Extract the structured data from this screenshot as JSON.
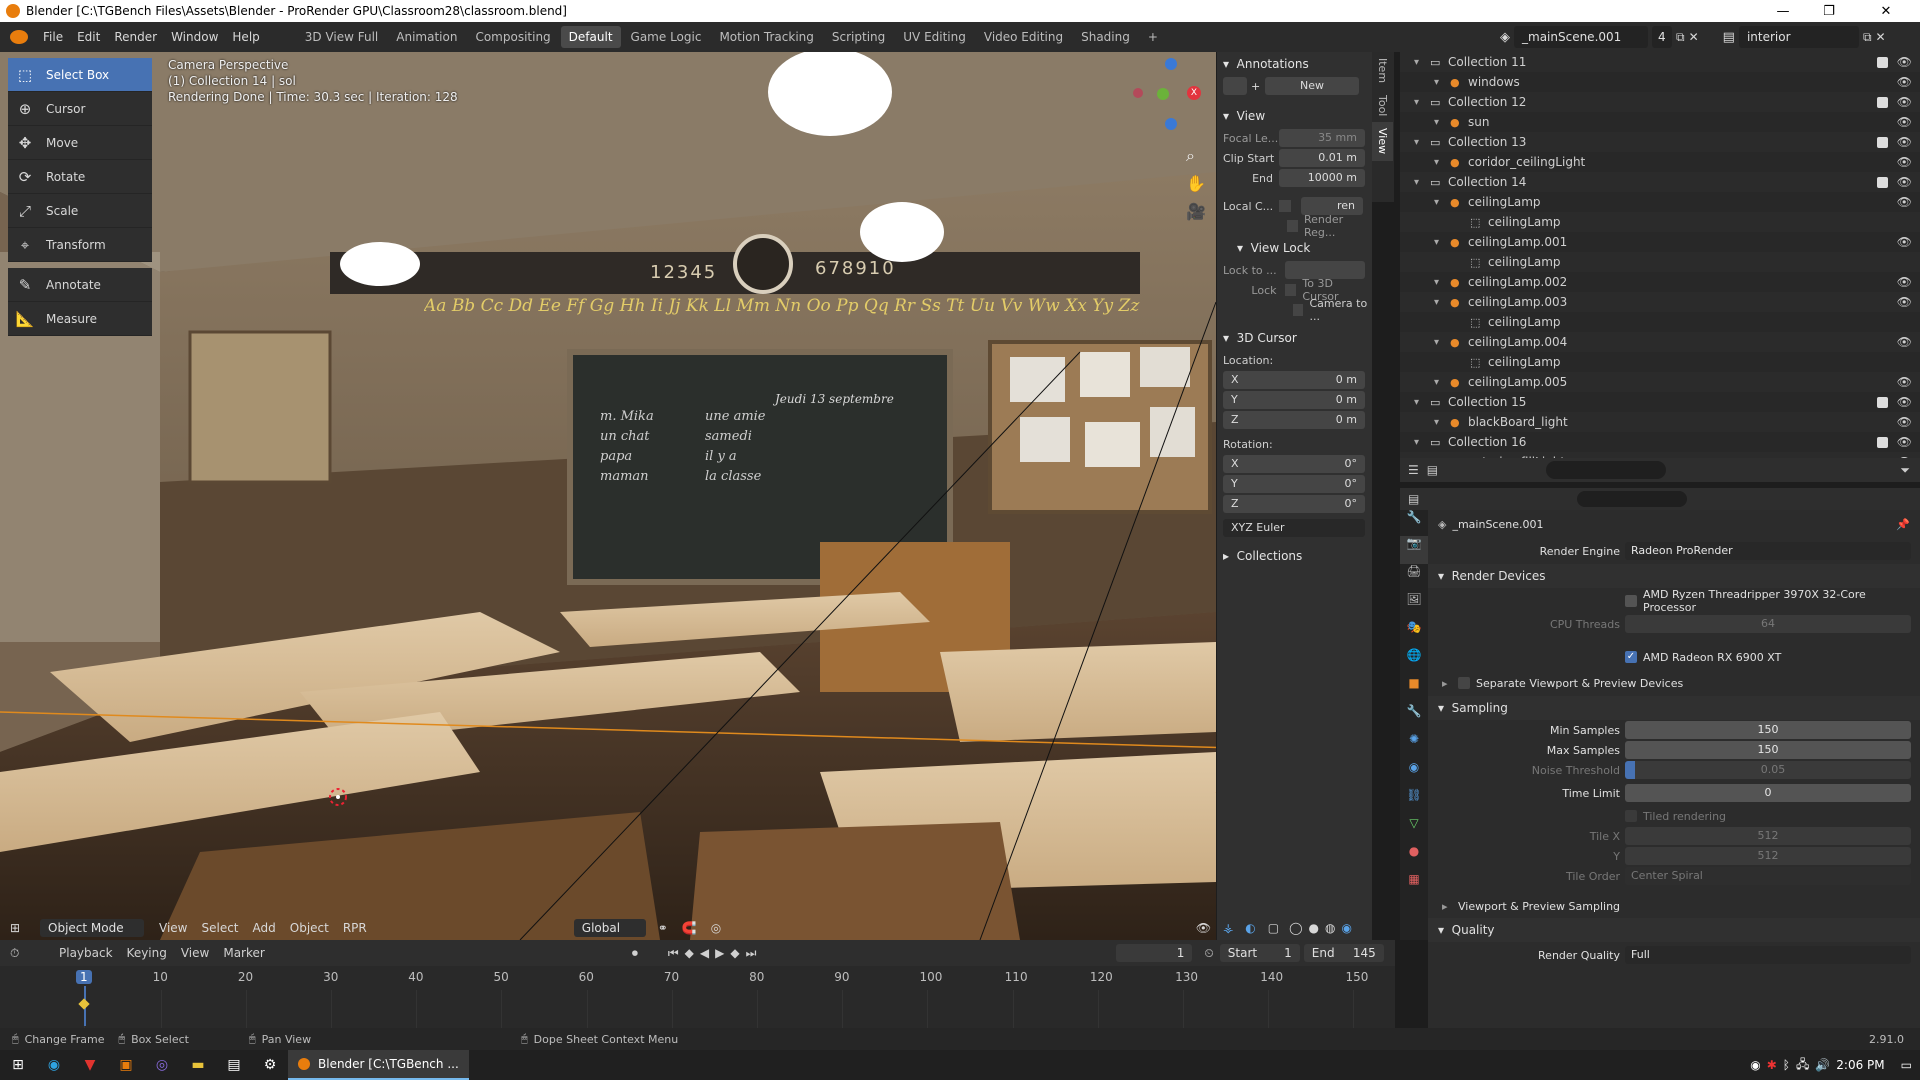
{
  "window": {
    "title": "Blender [C:\\TGBench Files\\Assets\\Blender - ProRender GPU\\Classroom28\\classroom.blend]",
    "minimize": "—",
    "maximize": "❐",
    "close": "✕"
  },
  "menu": [
    "File",
    "Edit",
    "Render",
    "Window",
    "Help"
  ],
  "workspaces": [
    "3D View Full",
    "Animation",
    "Compositing",
    "Default",
    "Game Logic",
    "Motion Tracking",
    "Scripting",
    "UV Editing",
    "Video Editing",
    "Shading"
  ],
  "active_workspace": "Default",
  "add_workspace": "+",
  "scene": {
    "name": "_mainScene.001",
    "users": "4",
    "view_layer": "interior"
  },
  "viewport": {
    "info_line1": "Camera Perspective",
    "info_line2": "(1) Collection 14 | sol",
    "info_line3": "Rendering Done | Time: 30.3 sec | Iteration: 128",
    "alphabet": "Aa Bb  Cc Dd Ee Ff Gg Hh Ii Jj Kk Ll Mm Nn Oo Pp Qq Rr Ss Tt Uu Vv Ww Xx Yy Zz",
    "numbers_left": "12345",
    "numbers_right": "678910",
    "board_date": "Jeudi 13 septembre",
    "board_words_1": [
      "m. Mika",
      "un chat",
      "papa",
      "maman"
    ],
    "board_words_2": [
      "une amie",
      "samedi",
      "il y a",
      "la classe"
    ]
  },
  "tools": [
    {
      "label": "Select Box",
      "icon": "select-box-icon",
      "active": true
    },
    {
      "label": "Cursor",
      "icon": "cursor-icon"
    },
    {
      "label": "Move",
      "icon": "move-icon"
    },
    {
      "label": "Rotate",
      "icon": "rotate-icon"
    },
    {
      "label": "Scale",
      "icon": "scale-icon"
    },
    {
      "label": "Transform",
      "icon": "transform-icon"
    },
    {
      "label": "Annotate",
      "icon": "annotate-icon"
    },
    {
      "label": "Measure",
      "icon": "measure-icon"
    }
  ],
  "npanel": {
    "tabs": [
      "Item",
      "Tool",
      "View"
    ],
    "annotations": "Annotations",
    "new": "New",
    "view": "View",
    "focal_label": "Focal Le...",
    "focal_value": "35 mm",
    "clip_start_label": "Clip Start",
    "clip_start_value": "0.01 m",
    "end_label": "End",
    "end_value": "10000 m",
    "local_camera_label": "Local C...",
    "local_camera_value": "ren",
    "render_region": "Render Reg...",
    "view_lock": "View Lock",
    "lock_to_label": "Lock to ...",
    "lock_label": "Lock",
    "to_3d_cursor": "To 3D Cursor",
    "camera_to": "Camera to ...",
    "cursor": "3D Cursor",
    "location": "Location:",
    "x": "X",
    "y": "Y",
    "z": "Z",
    "loc_x": "0 m",
    "loc_y": "0 m",
    "loc_z": "0 m",
    "rotation": "Rotation:",
    "rot_x": "0°",
    "rot_y": "0°",
    "rot_z": "0°",
    "rotation_mode": "XYZ Euler",
    "collections": "Collections"
  },
  "outliner": [
    {
      "label": "Collection 11",
      "depth": 0,
      "type": "collection",
      "checkbox": true
    },
    {
      "label": "windows",
      "depth": 1,
      "type": "object"
    },
    {
      "label": "Collection 12",
      "depth": 0,
      "type": "collection",
      "checkbox": true
    },
    {
      "label": "sun",
      "depth": 1,
      "type": "object"
    },
    {
      "label": "Collection 13",
      "depth": 0,
      "type": "collection",
      "checkbox": true
    },
    {
      "label": "coridor_ceilingLight",
      "depth": 1,
      "type": "object"
    },
    {
      "label": "Collection 14",
      "depth": 0,
      "type": "collection",
      "checkbox": true
    },
    {
      "label": "ceilingLamp",
      "depth": 1,
      "type": "object"
    },
    {
      "label": "ceilingLamp",
      "depth": 2,
      "type": "mesh"
    },
    {
      "label": "ceilingLamp.001",
      "depth": 1,
      "type": "object"
    },
    {
      "label": "ceilingLamp",
      "depth": 2,
      "type": "mesh"
    },
    {
      "label": "ceilingLamp.002",
      "depth": 1,
      "type": "object"
    },
    {
      "label": "ceilingLamp.003",
      "depth": 1,
      "type": "object"
    },
    {
      "label": "ceilingLamp",
      "depth": 2,
      "type": "mesh"
    },
    {
      "label": "ceilingLamp.004",
      "depth": 1,
      "type": "object"
    },
    {
      "label": "ceilingLamp",
      "depth": 2,
      "type": "mesh"
    },
    {
      "label": "ceilingLamp.005",
      "depth": 1,
      "type": "object"
    },
    {
      "label": "Collection 15",
      "depth": 0,
      "type": "collection",
      "checkbox": true
    },
    {
      "label": "blackBoard_light",
      "depth": 1,
      "type": "object"
    },
    {
      "label": "Collection 16",
      "depth": 0,
      "type": "collection",
      "checkbox": true
    },
    {
      "label": "exterior_fillLight",
      "depth": 1,
      "type": "object"
    }
  ],
  "properties": {
    "scene_name": "_mainScene.001",
    "render_engine_label": "Render Engine",
    "render_engine": "Radeon ProRender",
    "render_devices": "Render Devices",
    "cpu": "AMD Ryzen Threadripper 3970X 32-Core Processor",
    "cpu_threads_label": "CPU Threads",
    "cpu_threads": "64",
    "gpu": "AMD Radeon RX 6900 XT",
    "separate_devices": "Separate Viewport & Preview Devices",
    "sampling": "Sampling",
    "min_samples_label": "Min Samples",
    "min_samples": "150",
    "max_samples_label": "Max Samples",
    "max_samples": "150",
    "noise_threshold_label": "Noise Threshold",
    "noise_threshold": "0.05",
    "time_limit_label": "Time Limit",
    "time_limit": "0",
    "tiled_rendering": "Tiled rendering",
    "tile_x_label": "Tile X",
    "tile_x": "512",
    "tile_y_label": "Y",
    "tile_y": "512",
    "tile_order_label": "Tile Order",
    "tile_order": "Center Spiral",
    "viewport_sampling": "Viewport & Preview Sampling",
    "quality": "Quality",
    "render_quality_label": "Render Quality",
    "render_quality": "Full"
  },
  "vp_header": {
    "mode": "Object Mode",
    "view": "View",
    "select": "Select",
    "add": "Add",
    "object": "Object",
    "rpr": "RPR",
    "orientation": "Global"
  },
  "timeline": {
    "playback": "Playback",
    "keying": "Keying",
    "view": "View",
    "marker": "Marker",
    "current_frame": "1",
    "start_label": "Start",
    "start": "1",
    "end_label": "End",
    "end": "145",
    "ticks": [
      "1",
      "10",
      "20",
      "30",
      "40",
      "50",
      "60",
      "70",
      "80",
      "90",
      "100",
      "110",
      "120",
      "130",
      "140",
      "150"
    ]
  },
  "status": {
    "change_frame": "Change Frame",
    "box_select": "Box Select",
    "pan_view": "Pan View",
    "context_menu": "Dope Sheet Context Menu",
    "version": "2.91.0"
  },
  "taskbar": {
    "app_label": "Blender [C:\\TGBench ...",
    "time": "2:06 PM"
  }
}
